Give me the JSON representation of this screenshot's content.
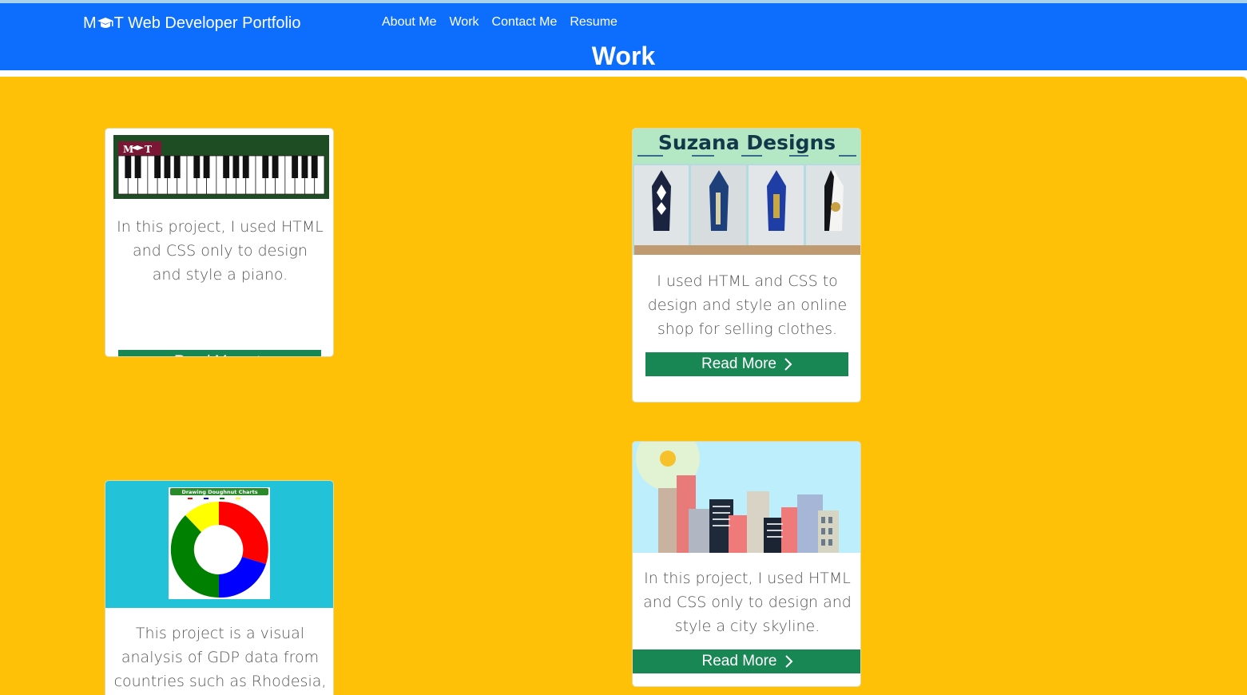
{
  "navbar": {
    "brand_prefix": "M",
    "brand_suffix": "T Web Developer Portfolio",
    "links": [
      "About Me",
      "Work",
      "Contact Me",
      "Resume"
    ],
    "page_title": "Work"
  },
  "cards": [
    {
      "image": "piano-keyboard-thumbnail",
      "image_badge": "M",
      "image_badge_suffix": "T",
      "text": "In this project, I used HTML and CSS only to design and style a piano.",
      "button": "Read More"
    },
    {
      "image": "online-clothes-shop-thumbnail",
      "image_title": "Suzana Designs",
      "text": "I used HTML and CSS to design and style an online shop for selling clothes.",
      "button": "Read More"
    },
    {
      "image": "doughnut-chart-thumbnail",
      "image_title": "Drawing Doughnut Charts",
      "text": "This project is a visual analysis of GDP data from countries such as Rhodesia, Zimbabwe,"
    },
    {
      "image": "city-skyline-thumbnail",
      "text": "In this project, I used HTML and CSS only to design and style a city skyline.",
      "button": "Read More"
    }
  ],
  "icons": {
    "brand_logo": "graduation-cap-icon",
    "button_chevron": "chevron-right-icon"
  },
  "colors": {
    "navbar": "#0d6efd",
    "main_background": "#ffc107",
    "button": "#198754",
    "card_background": "#ffffff"
  }
}
